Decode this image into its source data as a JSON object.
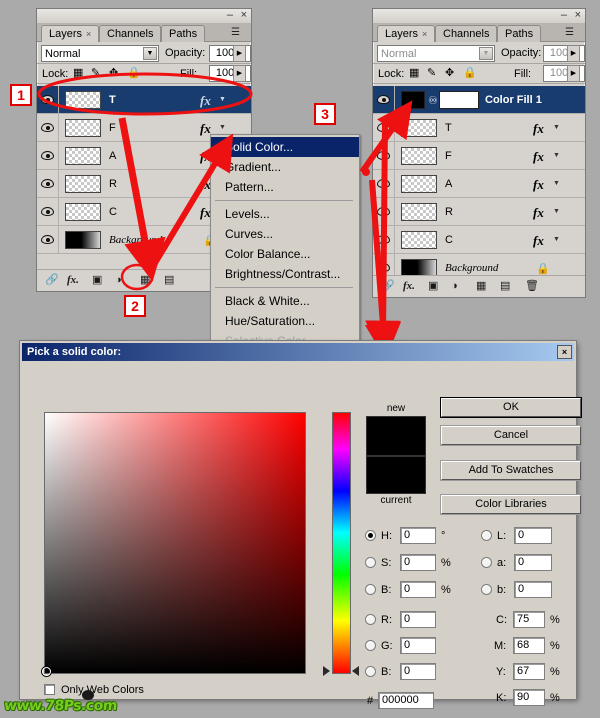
{
  "left_panel": {
    "tabs": [
      {
        "label": "Layers",
        "active": true,
        "close": "×"
      },
      {
        "label": "Channels",
        "active": false
      },
      {
        "label": "Paths",
        "active": false
      }
    ],
    "blend_mode": "Normal",
    "opacity_label": "Opacity:",
    "opacity_value": "100%",
    "lock_label": "Lock:",
    "fill_label": "Fill:",
    "fill_value": "100%",
    "min_glyph": "–",
    "close_glyph": "×",
    "layers": [
      {
        "name": "T",
        "thumb": "checker",
        "selected": true,
        "fx": true
      },
      {
        "name": "F",
        "thumb": "checker",
        "selected": false,
        "fx": true
      },
      {
        "name": "A",
        "thumb": "checker",
        "selected": false,
        "fx": true
      },
      {
        "name": "R",
        "thumb": "checker",
        "selected": false,
        "fx": true
      },
      {
        "name": "C",
        "thumb": "checker",
        "selected": false,
        "fx": true
      },
      {
        "name": "Background",
        "thumb": "gradblack",
        "selected": false,
        "fx": false,
        "locked": true,
        "italic": true
      }
    ],
    "bottom_icons": [
      "link-icon",
      "fx-icon",
      "mask-icon",
      "adjustment-icon",
      "group-icon",
      "new-layer-icon"
    ]
  },
  "right_panel": {
    "tabs": [
      {
        "label": "Layers",
        "active": true,
        "close": "×"
      },
      {
        "label": "Channels",
        "active": false
      },
      {
        "label": "Paths",
        "active": false
      }
    ],
    "blend_mode": "Normal",
    "opacity_label": "Opacity:",
    "opacity_value": "100%",
    "lock_label": "Lock:",
    "fill_label": "Fill:",
    "fill_value": "100%",
    "min_glyph": "–",
    "close_glyph": "×",
    "layers": [
      {
        "name": "Color Fill 1",
        "thumb": "solidblack",
        "mask": true,
        "selected": true,
        "fx": false
      },
      {
        "name": "T",
        "thumb": "checker",
        "selected": false,
        "fx": true
      },
      {
        "name": "F",
        "thumb": "checker",
        "selected": false,
        "fx": true
      },
      {
        "name": "A",
        "thumb": "checker",
        "selected": false,
        "fx": true
      },
      {
        "name": "R",
        "thumb": "checker",
        "selected": false,
        "fx": true
      },
      {
        "name": "C",
        "thumb": "checker",
        "selected": false,
        "fx": true
      },
      {
        "name": "Background",
        "thumb": "gradblack",
        "selected": false,
        "fx": false,
        "locked": true,
        "italic": true
      }
    ],
    "bottom_icons": [
      "link-icon",
      "fx-icon",
      "mask-icon",
      "adjustment-icon",
      "group-icon",
      "new-layer-icon",
      "trash-icon"
    ]
  },
  "context_menu": {
    "items": [
      {
        "label": "Solid Color...",
        "highlight": true
      },
      {
        "label": "Gradient...",
        "highlight": false
      },
      {
        "label": "Pattern...",
        "highlight": false
      },
      {
        "sep": true
      },
      {
        "label": "Levels...",
        "highlight": false
      },
      {
        "label": "Curves...",
        "highlight": false
      },
      {
        "label": "Color Balance...",
        "highlight": false
      },
      {
        "label": "Brightness/Contrast...",
        "highlight": false
      },
      {
        "sep": true
      },
      {
        "label": "Black & White...",
        "highlight": false
      },
      {
        "label": "Hue/Saturation...",
        "highlight": false
      },
      {
        "label": "Selective Color...",
        "highlight": false,
        "disabled": true
      }
    ]
  },
  "markers": [
    {
      "id": "1",
      "label": "1"
    },
    {
      "id": "2",
      "label": "2"
    },
    {
      "id": "3",
      "label": "3"
    }
  ],
  "color_picker": {
    "title": "Pick a solid color:",
    "close_glyph": "×",
    "new_label": "new",
    "current_label": "current",
    "new_color": "#000000",
    "current_color": "#000000",
    "buttons": {
      "ok": "OK",
      "cancel": "Cancel",
      "add_to_swatches": "Add To Swatches",
      "color_libraries": "Color Libraries"
    },
    "hsb": [
      {
        "key": "H",
        "label": "H:",
        "value": "0",
        "unit": "°",
        "selected": true
      },
      {
        "key": "S",
        "label": "S:",
        "value": "0",
        "unit": "%",
        "selected": false
      },
      {
        "key": "B",
        "label": "B:",
        "value": "0",
        "unit": "%",
        "selected": false
      }
    ],
    "rgb": [
      {
        "key": "R",
        "label": "R:",
        "value": "0",
        "unit": "",
        "selected": false
      },
      {
        "key": "G",
        "label": "G:",
        "value": "0",
        "unit": "",
        "selected": false
      },
      {
        "key": "B",
        "label": "B:",
        "value": "0",
        "unit": "",
        "selected": false
      }
    ],
    "lab": [
      {
        "key": "L",
        "label": "L:",
        "value": "0",
        "unit": "",
        "selected": false
      },
      {
        "key": "a",
        "label": "a:",
        "value": "0",
        "unit": "",
        "selected": false
      },
      {
        "key": "b",
        "label": "b:",
        "value": "0",
        "unit": "",
        "selected": false
      }
    ],
    "cmyk": [
      {
        "key": "C",
        "label": "C:",
        "value": "75",
        "unit": "%"
      },
      {
        "key": "M",
        "label": "M:",
        "value": "68",
        "unit": "%"
      },
      {
        "key": "Y",
        "label": "Y:",
        "value": "67",
        "unit": "%"
      },
      {
        "key": "K",
        "label": "K:",
        "value": "90",
        "unit": "%"
      }
    ],
    "hex_prefix": "#",
    "hex_value": "000000",
    "only_web_colors": "Only Web Colors"
  },
  "watermark": {
    "text": "www.78Ps.com"
  }
}
